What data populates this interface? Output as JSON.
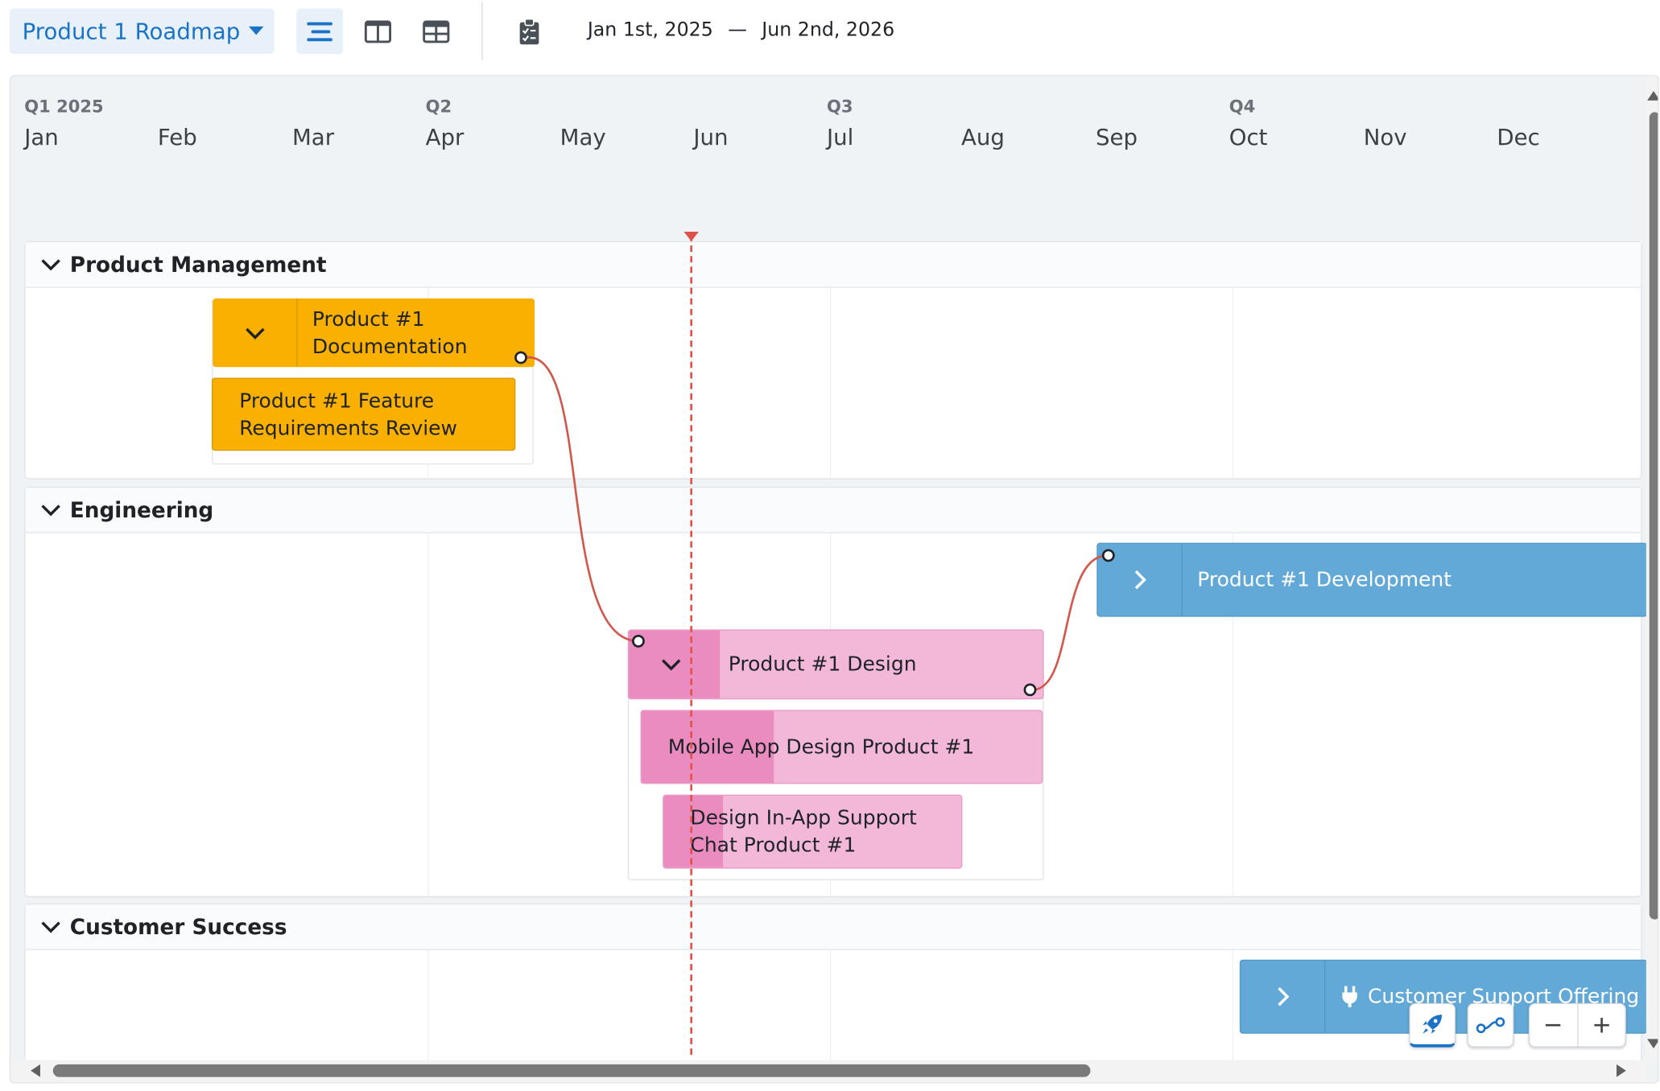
{
  "toolbar": {
    "roadmap_name": "Product 1 Roadmap",
    "date_start": "Jan 1st, 2025",
    "date_separator": "—",
    "date_end": "Jun 2nd, 2026",
    "active_color": "#1a73c6"
  },
  "timeline": {
    "quarters": [
      "Q1 2025",
      "Q2",
      "Q3",
      "Q4"
    ],
    "months": [
      "Jan",
      "Feb",
      "Mar",
      "Apr",
      "May",
      "Jun",
      "Jul",
      "Aug",
      "Sep",
      "Oct",
      "Nov",
      "Dec"
    ]
  },
  "lanes": {
    "product_management": {
      "title": "Product Management",
      "items": {
        "documentation": "Product #1 Documentation",
        "requirements": "Product #1 Feature Requirements Review"
      }
    },
    "engineering": {
      "title": "Engineering",
      "items": {
        "development": "Product #1 Development",
        "design": "Product #1 Design",
        "mobile_design": "Mobile App Design Product #1",
        "chat_design": "Design In-App Support Chat Product #1"
      },
      "progress": {
        "design": 0.22,
        "mobile_design": 0.33,
        "chat_design": 0.2
      }
    },
    "customer_success": {
      "title": "Customer Success",
      "items": {
        "support_offering": "Customer Support Offering"
      }
    }
  },
  "colors": {
    "pm": "#f9b000",
    "design": "#f3b8d7",
    "design_progress": "#ea8cc0",
    "development": "#63a9d8",
    "today_marker": "#e0514a",
    "dependency": "#d0584c"
  },
  "icons": {
    "list_view": "list-icon",
    "columns_view": "columns-icon",
    "table_view": "table-icon",
    "clipboard": "clipboard-icon",
    "rocket": "rocket-icon",
    "dependency": "dependency-icon",
    "plug": "plug-icon"
  }
}
